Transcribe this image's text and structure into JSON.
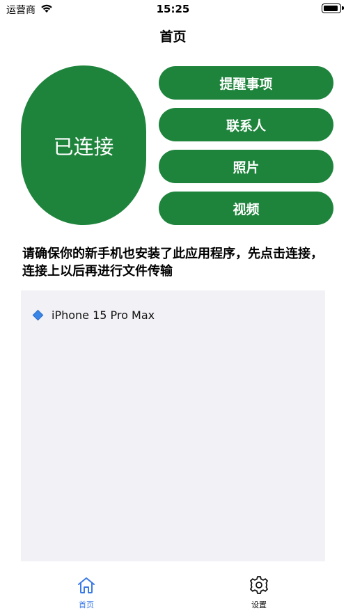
{
  "status_bar": {
    "carrier": "运营商",
    "time": "15:25",
    "battery_level": 0.95
  },
  "nav": {
    "title": "首页"
  },
  "connect": {
    "label": "已连接"
  },
  "menu": {
    "items": [
      {
        "label": "提醒事项"
      },
      {
        "label": "联系人"
      },
      {
        "label": "照片"
      },
      {
        "label": "视频"
      }
    ]
  },
  "instructions": "请确保你的新手机也安装了此应用程序，先点击连接，连接上以后再进行文件传输",
  "devices": [
    {
      "name": "iPhone 15 Pro Max",
      "icon": "blue-diamond-icon"
    }
  ],
  "tab_bar": {
    "tabs": [
      {
        "label": "首页",
        "icon": "home-icon",
        "active": true
      },
      {
        "label": "设置",
        "icon": "gear-icon",
        "active": false
      }
    ]
  },
  "colors": {
    "accent_green": "#1e843c",
    "tab_active": "#3b7ae6",
    "panel_bg": "#f1f1f6"
  }
}
